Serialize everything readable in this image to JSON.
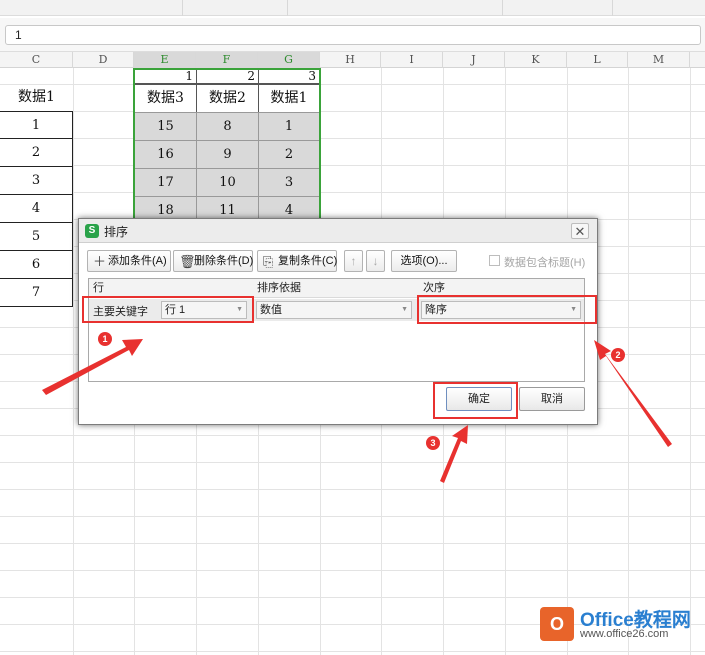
{
  "formula_bar": {
    "value": "1"
  },
  "columns": [
    "C",
    "D",
    "E",
    "F",
    "G",
    "H",
    "I",
    "J",
    "K",
    "L",
    "M"
  ],
  "source_table": {
    "header": "数据1",
    "values": [
      "1",
      "2",
      "3",
      "4",
      "5",
      "6",
      "7"
    ]
  },
  "selected_table": {
    "row_numbers": [
      "1",
      "2",
      "3"
    ],
    "headers": [
      "数据3",
      "数据2",
      "数据1"
    ],
    "rows": [
      [
        "15",
        "8",
        "1"
      ],
      [
        "16",
        "9",
        "2"
      ],
      [
        "17",
        "10",
        "3"
      ],
      [
        "18",
        "11",
        "4"
      ]
    ]
  },
  "dialog": {
    "title": "排序",
    "toolbar": {
      "add_condition": "添加条件(A)",
      "delete_condition": "删除条件(D)",
      "copy_condition": "复制条件(C)",
      "up_arrow": "↑",
      "down_arrow": "↓",
      "options": "选项(O)...",
      "header_checkbox": "数据包含标题(H)"
    },
    "panel_headers": {
      "row": "行",
      "sort_basis": "排序依据",
      "order": "次序"
    },
    "condition": {
      "label": "主要关键字",
      "key": "行 1",
      "basis": "数值",
      "order": "降序"
    },
    "ok_button": "确定",
    "cancel_button": "取消"
  },
  "annotations": {
    "badge_1": "1",
    "badge_2": "2",
    "badge_3": "3",
    "color": "#e8312f"
  },
  "watermark": {
    "brand": "Office教程网",
    "url": "www.office26.com"
  }
}
